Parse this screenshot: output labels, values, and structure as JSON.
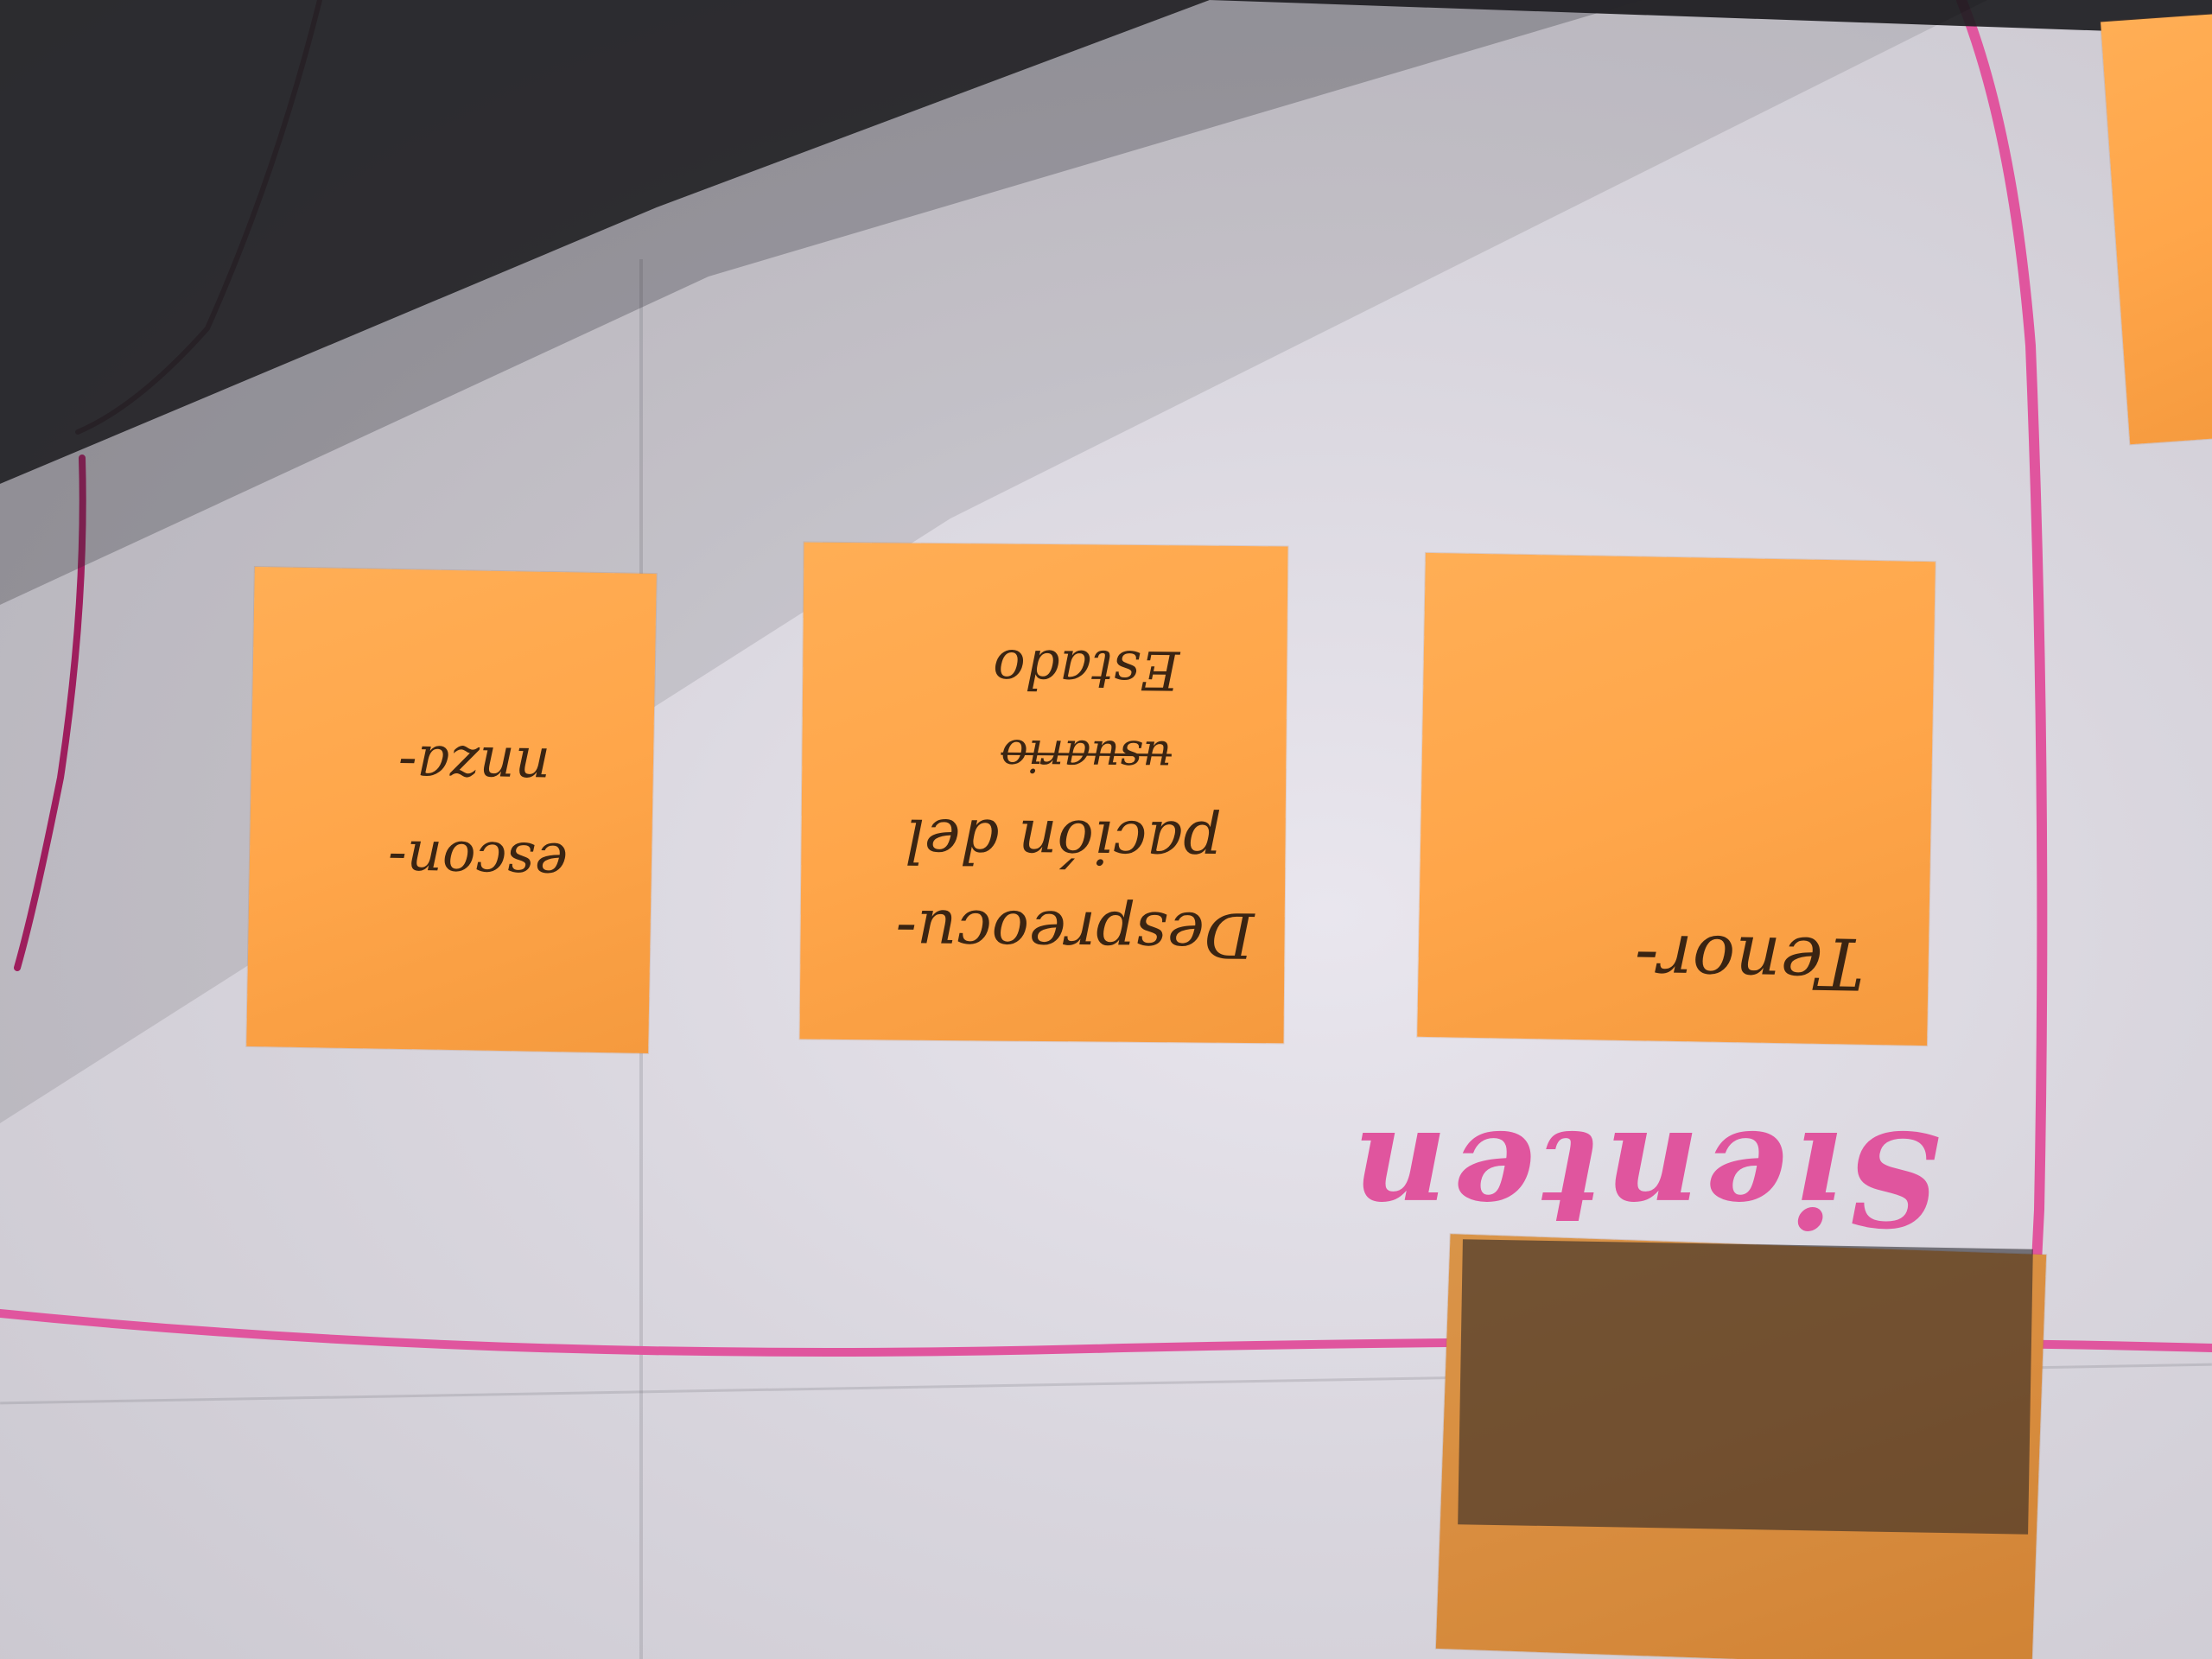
{
  "notes": [
    {
      "id": "left",
      "lines": [
        "escon-",
        "nnza-"
      ]
    },
    {
      "id": "center",
      "lines": [
        "Despreocu-",
        "pación del",
        "usuario",
        "Estado"
      ],
      "struck": [
        2
      ]
    },
    {
      "id": "right",
      "lines": [
        "Tenor-"
      ]
    }
  ],
  "board_label": "Sienten",
  "colors": {
    "note": "#ffa64a",
    "marker": "#e0559e",
    "paper": "#dcd9e0",
    "ink": "#3a2412"
  }
}
